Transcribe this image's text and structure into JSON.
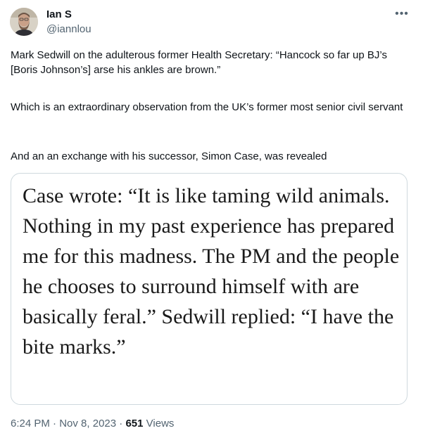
{
  "author": {
    "name": "Ian S",
    "handle": "@iannlou",
    "avatar": "avatar-photo"
  },
  "more_icon": "more-horizontal-icon",
  "more_glyph": "•••",
  "paragraphs": [
    "Mark Sedwill on the adulterous former Health Secretary: “Hancock so far up BJ’s [Boris Johnson’s] arse his ankles are brown.”",
    "Which is an extraordinary observation from the UK’s former most senior civil servant",
    "And an an exchange with his successor, Simon Case, was revealed"
  ],
  "quote_image_text": "Case wrote: “It is like taming wild animals. Nothing in my past experience has prepared me for this madness. The PM and the people he chooses to surround himself with are basically feral.” Sedwill replied: “I have the bite marks.”",
  "meta": {
    "time": "6:24 PM",
    "separator": "·",
    "date": "Nov 8, 2023",
    "views_count": "651",
    "views_label": "Views"
  },
  "colors": {
    "text": "#0f1419",
    "secondary": "#536471",
    "border": "#cfd9de"
  }
}
